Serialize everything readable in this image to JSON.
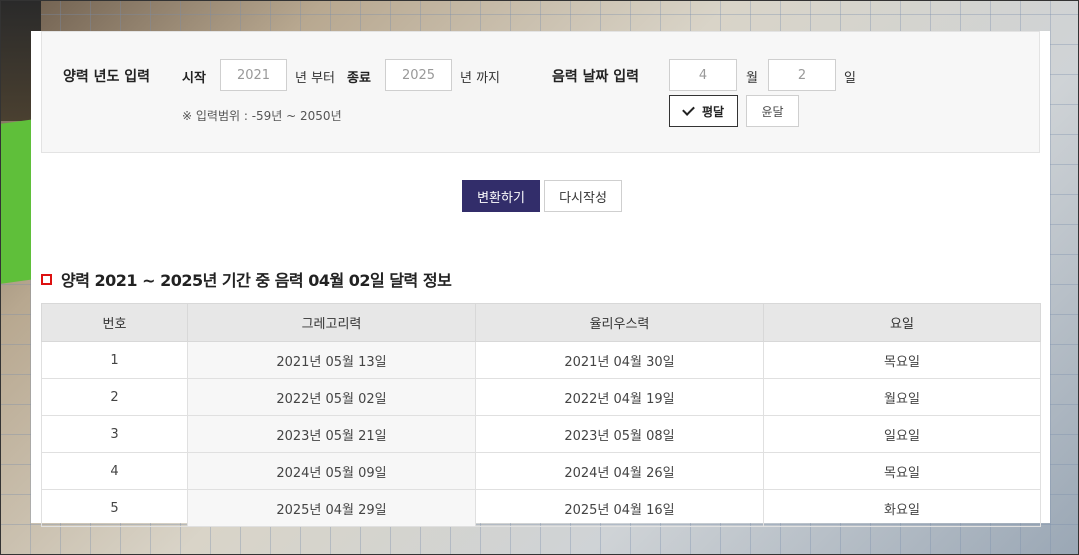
{
  "form": {
    "solar_year_label": "양력 년도 입력",
    "start_label": "시작",
    "start_value": "2021",
    "from_suffix": "년 부터",
    "end_label": "종료",
    "end_value": "2025",
    "to_suffix": "년 까지",
    "range_note": "※ 입력범위 : -59년 ~ 2050년",
    "lunar_date_label": "음력 날짜 입력",
    "month_value": "4",
    "month_suffix": "월",
    "day_value": "2",
    "day_suffix": "일",
    "leap_options": {
      "normal": "평달",
      "leap": "윤달",
      "selected": "평달"
    }
  },
  "buttons": {
    "convert": "변환하기",
    "reset": "다시작성"
  },
  "results": {
    "title": "양력 2021 ~ 2025년 기간 중 음력 04월 02일 달력 정보",
    "columns": [
      "번호",
      "그레고리력",
      "율리우스력",
      "요일"
    ],
    "rows": [
      [
        "1",
        "2021년 05월 13일",
        "2021년 04월 30일",
        "목요일"
      ],
      [
        "2",
        "2022년 05월 02일",
        "2022년 04월 19일",
        "월요일"
      ],
      [
        "3",
        "2023년 05월 21일",
        "2023년 05월 08일",
        "일요일"
      ],
      [
        "4",
        "2024년 05월 09일",
        "2024년 04월 26일",
        "목요일"
      ],
      [
        "5",
        "2025년 04월 29일",
        "2025년 04월 16일",
        "화요일"
      ]
    ]
  },
  "colors": {
    "primary_button": "#322d6a",
    "title_marker": "#dd1111"
  }
}
